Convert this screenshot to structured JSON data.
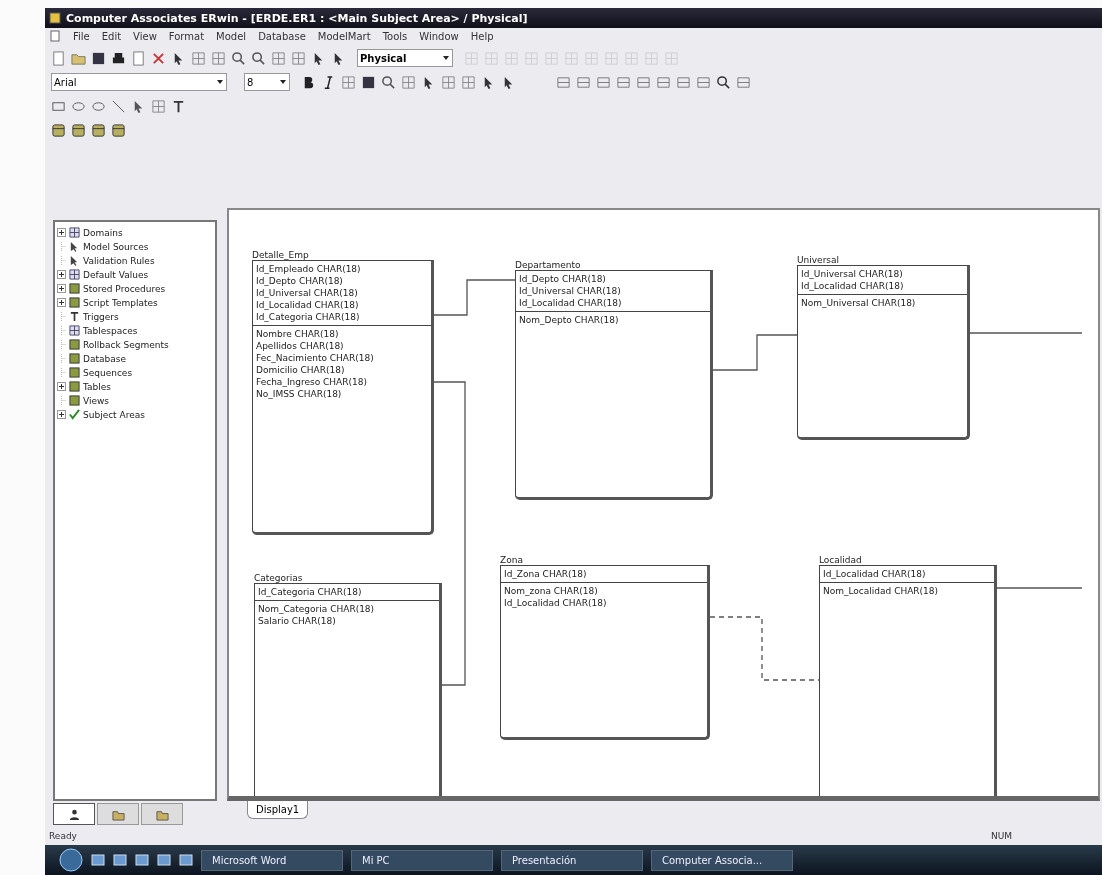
{
  "window": {
    "title": "Computer Associates ERwin - [ERDE.ER1 : <Main Subject Area> / Physical]"
  },
  "menu": [
    "File",
    "Edit",
    "View",
    "Format",
    "Model",
    "Database",
    "ModelMart",
    "Tools",
    "Window",
    "Help"
  ],
  "toolbar": {
    "model_view": "Physical",
    "font": "Arial",
    "font_size": "8"
  },
  "model_tree": [
    {
      "label": "Domains",
      "has_children": true,
      "expanded": false
    },
    {
      "label": "Model Sources",
      "has_children": false
    },
    {
      "label": "Validation Rules",
      "has_children": false
    },
    {
      "label": "Default Values",
      "has_children": true,
      "expanded": false
    },
    {
      "label": "Stored Procedures",
      "has_children": true,
      "expanded": false
    },
    {
      "label": "Script Templates",
      "has_children": true,
      "expanded": false
    },
    {
      "label": "Triggers",
      "has_children": false
    },
    {
      "label": "Tablespaces",
      "has_children": false
    },
    {
      "label": "Rollback Segments",
      "has_children": false
    },
    {
      "label": "Database",
      "has_children": false
    },
    {
      "label": "Sequences",
      "has_children": false
    },
    {
      "label": "Tables",
      "has_children": true,
      "expanded": false
    },
    {
      "label": "Views",
      "has_children": false
    },
    {
      "label": "Subject Areas",
      "has_children": true,
      "expanded": false
    }
  ],
  "panel_tabs": [
    {
      "selected": true
    },
    {
      "selected": false
    },
    {
      "selected": false
    }
  ],
  "entities": [
    {
      "name": "Detalle_Emp",
      "keys": [
        "Id_Empleado CHAR(18)",
        "Id_Depto CHAR(18)",
        "Id_Universal CHAR(18)",
        "Id_Localidad CHAR(18)",
        "Id_Categoria CHAR(18)"
      ],
      "attributes": [
        "Nombre CHAR(18)",
        "Apellidos CHAR(18)",
        "Fec_Nacimiento CHAR(18)",
        "Domicilio CHAR(18)",
        "Fecha_Ingreso CHAR(18)",
        "No_IMSS CHAR(18)"
      ]
    },
    {
      "name": "Departamento",
      "keys": [
        "Id_Depto CHAR(18)",
        "Id_Universal CHAR(18)",
        "Id_Localidad CHAR(18)"
      ],
      "attributes": [
        "Nom_Depto CHAR(18)"
      ]
    },
    {
      "name": "Universal",
      "keys": [
        "Id_Universal CHAR(18)",
        "Id_Localidad CHAR(18)"
      ],
      "attributes": [
        "Nom_Universal CHAR(18)"
      ]
    },
    {
      "name": "Categorias",
      "keys": [
        "Id_Categoria CHAR(18)"
      ],
      "attributes": [
        "Nom_Categoria CHAR(18)",
        "Salario CHAR(18)"
      ]
    },
    {
      "name": "Zona",
      "keys": [
        "Id_Zona CHAR(18)"
      ],
      "attributes": [
        "Nom_zona CHAR(18)",
        "Id_Localidad CHAR(18)"
      ]
    },
    {
      "name": "Localidad",
      "keys": [
        "Id_Localidad CHAR(18)"
      ],
      "attributes": [
        "Nom_Localidad CHAR(18)"
      ]
    }
  ],
  "diagram_tabs": [
    {
      "label": "Display1",
      "selected": true
    }
  ],
  "status_bar": {
    "left": "Ready",
    "right": "NUM"
  },
  "taskbar": [
    "Microsoft Word",
    "Mi PC",
    "Presentación",
    "Computer Associa..."
  ]
}
